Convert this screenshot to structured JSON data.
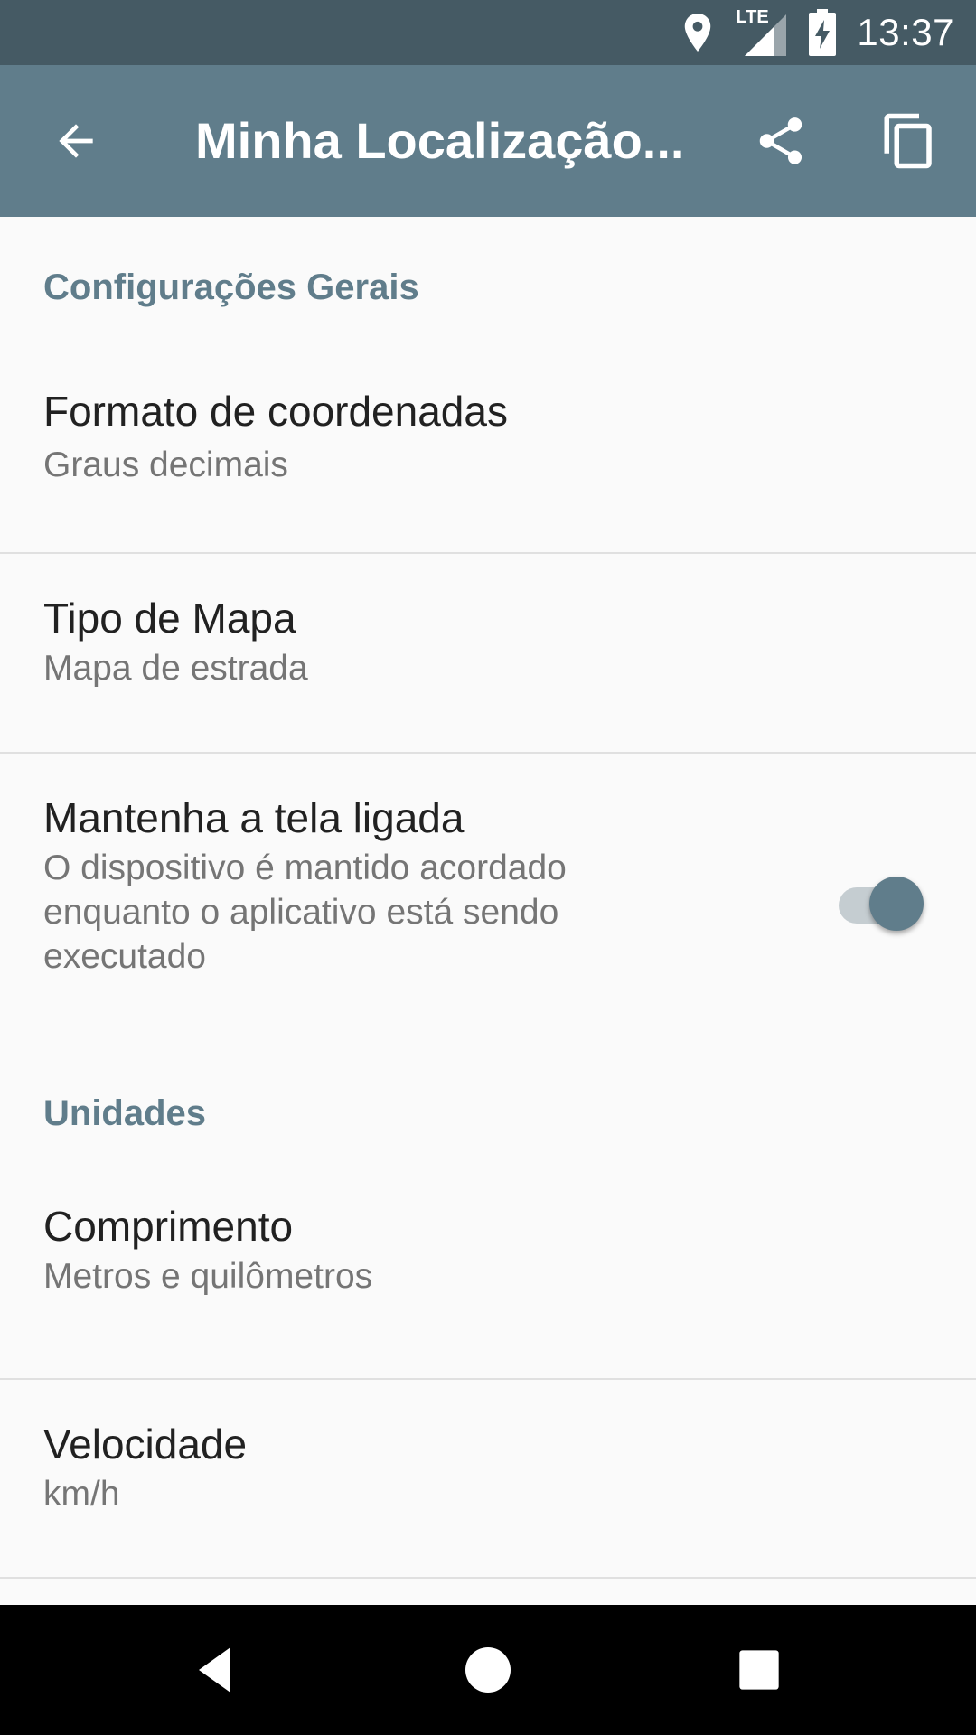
{
  "status_bar": {
    "time": "13:37",
    "network": "LTE",
    "icons": [
      "location-icon",
      "signal-icon",
      "battery-charging-icon"
    ]
  },
  "app_bar": {
    "title": "Minha Localização...",
    "back_icon": "arrow-back-icon",
    "share_icon": "share-icon",
    "copy_icon": "copy-icon",
    "color": "#607d8b"
  },
  "sections": {
    "general": {
      "header": "Configurações Gerais",
      "items": [
        {
          "title": "Formato de coordenadas",
          "summary": "Graus decimais"
        },
        {
          "title": "Tipo de Mapa",
          "summary": "Mapa de estrada"
        },
        {
          "title": "Mantenha a tela ligada",
          "summary": "O dispositivo é mantido acordado enquanto o aplicativo está sendo executado",
          "switch_on": true
        }
      ]
    },
    "units": {
      "header": "Unidades",
      "items": [
        {
          "title": "Comprimento",
          "summary": "Metros e quilômetros"
        },
        {
          "title": "Velocidade",
          "summary": "km/h"
        }
      ]
    }
  },
  "nav_bar": {
    "icons": [
      "back-triangle-icon",
      "home-circle-icon",
      "recents-square-icon"
    ]
  },
  "colors": {
    "status_bar": "#455a64",
    "app_bar": "#607d8b",
    "accent": "#607d8b",
    "background": "#fafafa"
  }
}
